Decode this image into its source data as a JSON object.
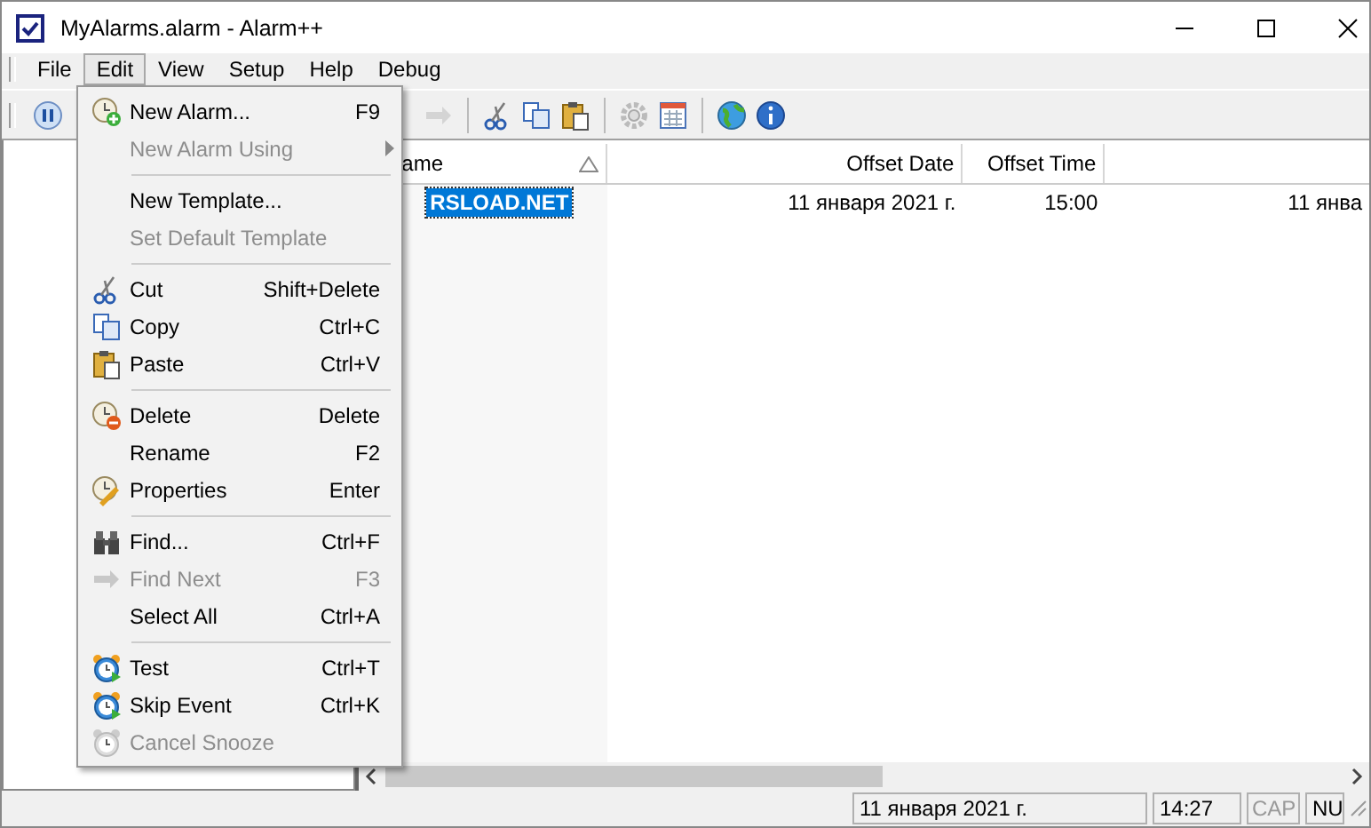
{
  "window": {
    "title": "MyAlarms.alarm - Alarm++"
  },
  "menubar": [
    {
      "label": "File",
      "selected": false
    },
    {
      "label": "Edit",
      "selected": true
    },
    {
      "label": "View",
      "selected": false
    },
    {
      "label": "Setup",
      "selected": false
    },
    {
      "label": "Help",
      "selected": false
    },
    {
      "label": "Debug",
      "selected": false
    }
  ],
  "menu": [
    {
      "kind": "item",
      "label": "New Alarm...",
      "shortcut": "F9",
      "disabled": false
    },
    {
      "kind": "item",
      "label": "New Alarm Using",
      "disabled": true,
      "submenu": true
    },
    {
      "kind": "separator"
    },
    {
      "kind": "item",
      "label": "New Template...",
      "disabled": false
    },
    {
      "kind": "item",
      "label": "Set Default Template",
      "disabled": true
    },
    {
      "kind": "separator"
    },
    {
      "kind": "item",
      "label": "Cut",
      "shortcut": "Shift+Delete",
      "disabled": false
    },
    {
      "kind": "item",
      "label": "Copy",
      "shortcut": "Ctrl+C",
      "disabled": false
    },
    {
      "kind": "item",
      "label": "Paste",
      "shortcut": "Ctrl+V",
      "disabled": false
    },
    {
      "kind": "separator"
    },
    {
      "kind": "item",
      "label": "Delete",
      "shortcut": "Delete",
      "disabled": false
    },
    {
      "kind": "item",
      "label": "Rename",
      "shortcut": "F2",
      "disabled": false
    },
    {
      "kind": "item",
      "label": "Properties",
      "shortcut": "Enter",
      "disabled": false
    },
    {
      "kind": "separator"
    },
    {
      "kind": "item",
      "label": "Find...",
      "shortcut": "Ctrl+F",
      "disabled": false
    },
    {
      "kind": "item",
      "label": "Find Next",
      "shortcut": "F3",
      "disabled": true
    },
    {
      "kind": "item",
      "label": "Select All",
      "shortcut": "Ctrl+A",
      "disabled": false
    },
    {
      "kind": "separator"
    },
    {
      "kind": "item",
      "label": "Test",
      "shortcut": "Ctrl+T",
      "disabled": false
    },
    {
      "kind": "item",
      "label": "Skip Event",
      "shortcut": "Ctrl+K",
      "disabled": false
    },
    {
      "kind": "item",
      "label": "Cancel Snooze",
      "disabled": true
    }
  ],
  "table": {
    "columns": [
      "ame",
      "Offset Date",
      "Offset Time"
    ],
    "rows": [
      {
        "selected": true,
        "cells": [
          "RSLOAD.NET",
          "11 января 2021 г.",
          "15:00",
          "11 янва"
        ]
      }
    ]
  },
  "status_bar": [
    {
      "text": "11 января 2021 г.",
      "disabled": false
    },
    {
      "text": "14:27",
      "disabled": false
    },
    {
      "text": "CAP",
      "disabled": true
    },
    {
      "text": "NU",
      "disabled": false
    }
  ]
}
